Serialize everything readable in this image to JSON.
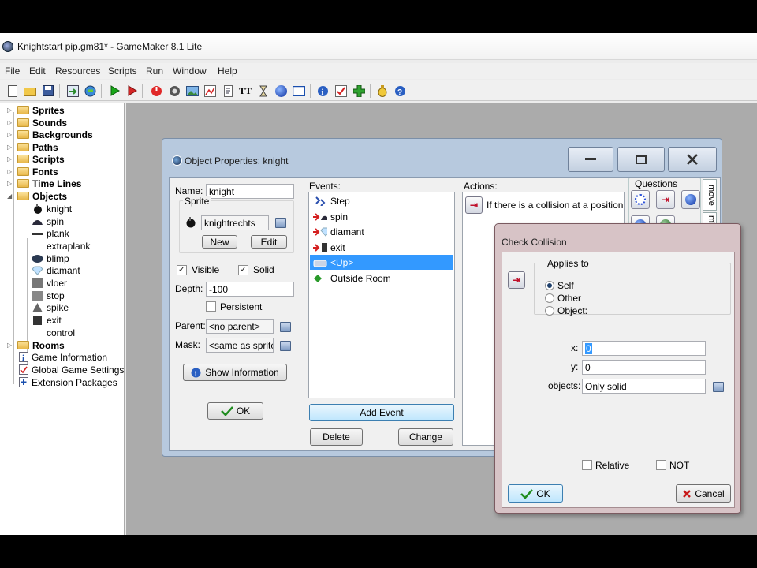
{
  "window": {
    "title": "Knightstart pip.gm81* - GameMaker 8.1 Lite"
  },
  "menu": [
    "File",
    "Edit",
    "Resources",
    "Scripts",
    "Run",
    "Window",
    "Help"
  ],
  "toolbar_icons": [
    "new-file-icon",
    "open-folder-icon",
    "save-icon",
    "create-exe-icon",
    "publish-icon",
    "run-icon",
    "run-debug-icon",
    "add-sprite-icon",
    "add-sound-icon",
    "add-background-icon",
    "add-path-icon",
    "add-script-icon",
    "add-font-icon",
    "add-timeline-icon",
    "add-object-icon",
    "add-room-icon",
    "game-information-icon",
    "game-settings-icon",
    "extension-packages-icon",
    "manual-icon",
    "help-icon"
  ],
  "tree": {
    "items": [
      {
        "label": "Sprites",
        "kind": "folder"
      },
      {
        "label": "Sounds",
        "kind": "folder"
      },
      {
        "label": "Backgrounds",
        "kind": "folder"
      },
      {
        "label": "Paths",
        "kind": "folder"
      },
      {
        "label": "Scripts",
        "kind": "folder"
      },
      {
        "label": "Fonts",
        "kind": "folder"
      },
      {
        "label": "Time Lines",
        "kind": "folder"
      },
      {
        "label": "Objects",
        "kind": "folder-open"
      },
      {
        "label": "knight",
        "kind": "object"
      },
      {
        "label": "spin",
        "kind": "object"
      },
      {
        "label": "plank",
        "kind": "object"
      },
      {
        "label": "extraplank",
        "kind": "object"
      },
      {
        "label": "blimp",
        "kind": "object"
      },
      {
        "label": "diamant",
        "kind": "object"
      },
      {
        "label": "vloer",
        "kind": "object"
      },
      {
        "label": "stop",
        "kind": "object"
      },
      {
        "label": "spike",
        "kind": "object"
      },
      {
        "label": "exit",
        "kind": "object"
      },
      {
        "label": "control",
        "kind": "object"
      },
      {
        "label": "Rooms",
        "kind": "folder"
      },
      {
        "label": "Game Information",
        "kind": "leaf"
      },
      {
        "label": "Global Game Settings",
        "kind": "leaf"
      },
      {
        "label": "Extension Packages",
        "kind": "leaf"
      }
    ]
  },
  "objprops": {
    "title": "Object Properties: knight",
    "name_label": "Name:",
    "name_value": "knight",
    "sprite_group": "Sprite",
    "sprite_value": "knightrechts",
    "new_label": "New",
    "edit_label": "Edit",
    "visible_label": "Visible",
    "visible_checked": true,
    "solid_label": "Solid",
    "solid_checked": true,
    "depth_label": "Depth:",
    "depth_value": "-100",
    "persistent_label": "Persistent",
    "persistent_checked": false,
    "parent_label": "Parent:",
    "parent_value": "<no parent>",
    "mask_label": "Mask:",
    "mask_value": "<same as sprite>",
    "show_info_label": "Show Information",
    "ok_label": "OK",
    "events_label": "Events:",
    "events": [
      {
        "label": "Step",
        "selected": false
      },
      {
        "label": "spin",
        "selected": false
      },
      {
        "label": "diamant",
        "selected": false
      },
      {
        "label": "exit",
        "selected": false
      },
      {
        "label": "<Up>",
        "selected": true
      },
      {
        "label": "Outside Room",
        "selected": false
      }
    ],
    "add_event_label": "Add Event",
    "delete_label": "Delete",
    "change_label": "Change",
    "actions_label": "Actions:",
    "actions": [
      {
        "label": "If there is a collision at a position"
      }
    ],
    "questions_label": "Questions",
    "tab_move": "move",
    "tab_main": "mi"
  },
  "collision_dialog": {
    "title": "Check Collision",
    "applies_to": "Applies to",
    "options": [
      {
        "label": "Self",
        "checked": true
      },
      {
        "label": "Other",
        "checked": false
      },
      {
        "label": "Object:",
        "checked": false
      }
    ],
    "x_label": "x:",
    "x_value": "0",
    "y_label": "y:",
    "y_value": "0",
    "objects_label": "objects:",
    "objects_value": "Only solid",
    "relative_label": "Relative",
    "not_label": "NOT",
    "ok_label": "OK",
    "cancel_label": "Cancel"
  },
  "colors": {
    "selection": "#3399ff",
    "objwin_frame": "#b7c9de",
    "dialog_frame": "#d7c3c6",
    "mdi_background": "#ababab"
  }
}
